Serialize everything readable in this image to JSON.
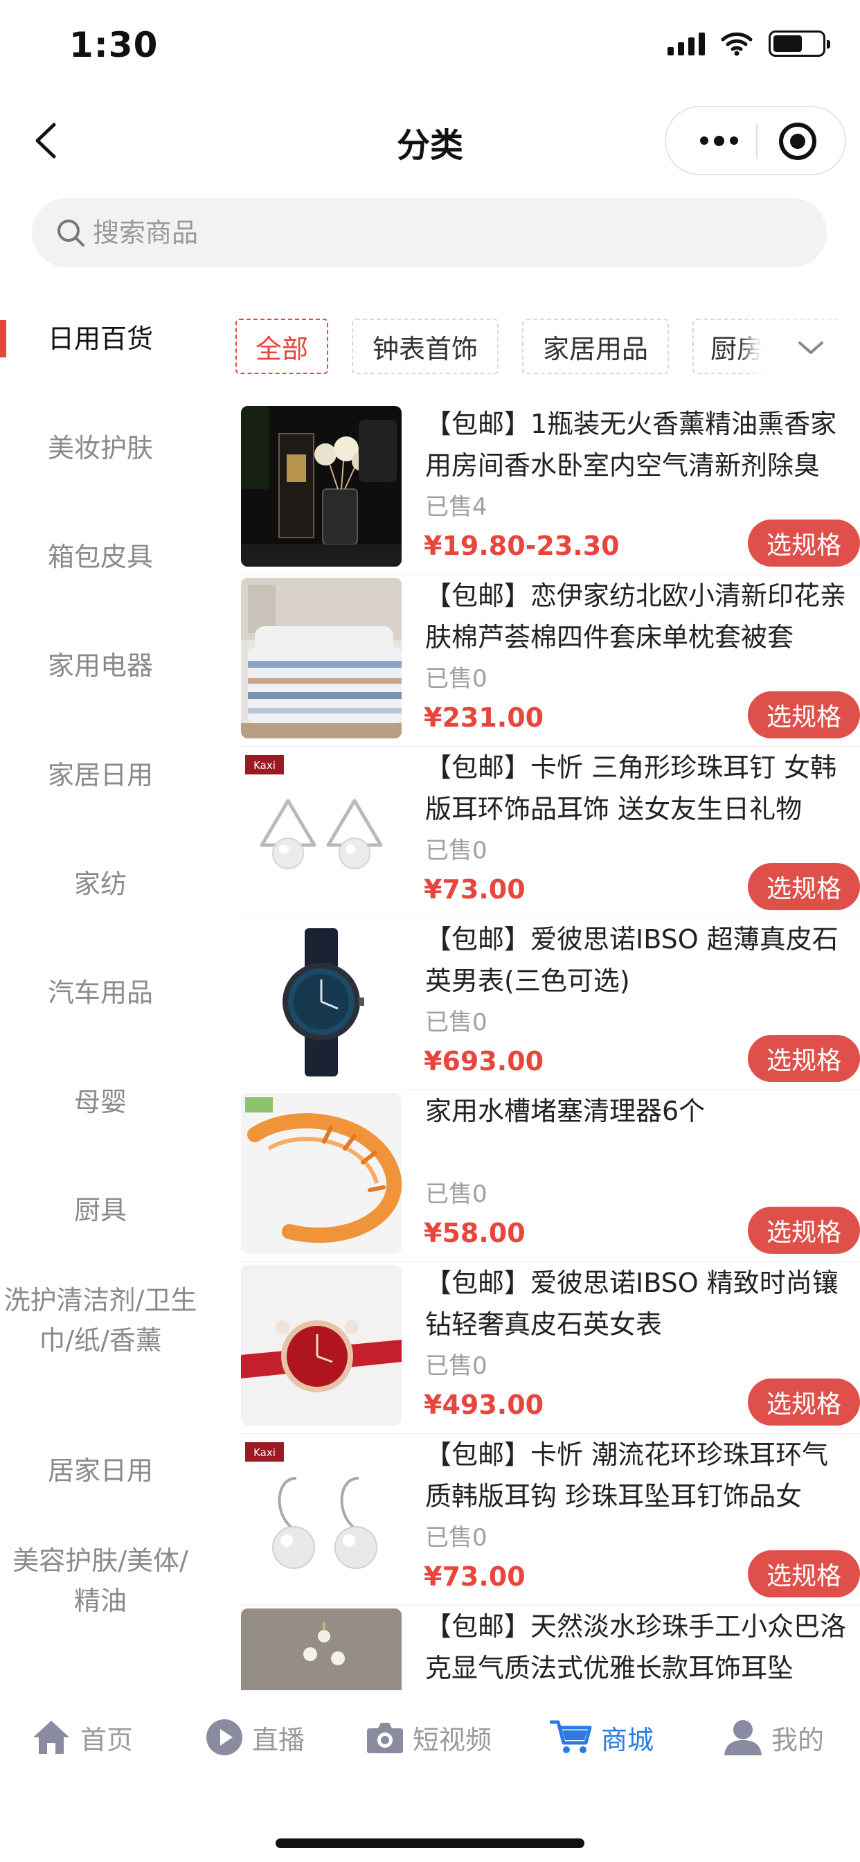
{
  "status_bar": {
    "time": "1:30"
  },
  "nav": {
    "title": "分类"
  },
  "search": {
    "placeholder": "搜索商品"
  },
  "sidebar": {
    "items": [
      {
        "label": "日用百货",
        "active": true
      },
      {
        "label": "美妆护肤"
      },
      {
        "label": "箱包皮具"
      },
      {
        "label": "家用电器"
      },
      {
        "label": "家居日用"
      },
      {
        "label": "家纺"
      },
      {
        "label": "汽车用品"
      },
      {
        "label": "母婴"
      },
      {
        "label": "厨具"
      },
      {
        "label": "洗护清洁剂/卫生巾/纸/香薰"
      },
      {
        "label": "居家日用"
      },
      {
        "label": "美容护肤/美体/精油"
      }
    ]
  },
  "chips": [
    {
      "label": "全部",
      "active": true
    },
    {
      "label": "钟表首饰"
    },
    {
      "label": "家居用品"
    },
    {
      "label": "厨房用品"
    }
  ],
  "products": [
    {
      "title": "【包邮】1瓶装无火香薰精油熏香家用房间香水卧室内空气清新剂除臭",
      "sold": "已售4",
      "price": "¥19.80-23.30",
      "button": "选规格",
      "image": "aroma-diffuser"
    },
    {
      "title": "【包邮】恋伊家纺北欧小清新印花亲肤棉芦荟棉四件套床单枕套被套",
      "sold": "已售0",
      "price": "¥231.00",
      "button": "选规格",
      "image": "bedding-set"
    },
    {
      "title": "【包邮】卡忻 三角形珍珠耳钉 女韩版耳环饰品耳饰 送女友生日礼物",
      "sold": "已售0",
      "price": "¥73.00",
      "button": "选规格",
      "image": "pearl-triangle-earrings"
    },
    {
      "title": "【包邮】爱彼思诺IBSO 超薄真皮石英男表(三色可选)",
      "sold": "已售0",
      "price": "¥693.00",
      "button": "选规格",
      "image": "mens-watch"
    },
    {
      "title": "家用水槽堵塞清理器6个",
      "sold": "已售0",
      "price": "¥58.00",
      "button": "选规格",
      "image": "drain-cleaner"
    },
    {
      "title": "【包邮】爱彼思诺IBSO 精致时尚镶钻轻奢真皮石英女表",
      "sold": "已售0",
      "price": "¥493.00",
      "button": "选规格",
      "image": "womens-watch"
    },
    {
      "title": "【包邮】卡忻 潮流花环珍珠耳环气质韩版耳钩 珍珠耳坠耳钉饰品女",
      "sold": "已售0",
      "price": "¥73.00",
      "button": "选规格",
      "image": "pearl-hook-earrings"
    },
    {
      "title": "【包邮】天然淡水珍珠手工小众巴洛克显气质法式优雅长款耳饰耳坠",
      "sold": "",
      "price": "",
      "button": "",
      "image": "baroque-pearl-earrings"
    }
  ],
  "image_text": {
    "brand": "Kaxi"
  },
  "tabbar": [
    {
      "label": "首页",
      "icon": "home-icon"
    },
    {
      "label": "直播",
      "icon": "play-icon"
    },
    {
      "label": "短视频",
      "icon": "camera-icon"
    },
    {
      "label": "商城",
      "icon": "cart-icon",
      "active": true
    },
    {
      "label": "我的",
      "icon": "user-icon"
    }
  ],
  "colors": {
    "accent": "#e8453c",
    "button": "#e0504a",
    "tab_active": "#2a7be4",
    "muted": "#9a9a9a"
  }
}
